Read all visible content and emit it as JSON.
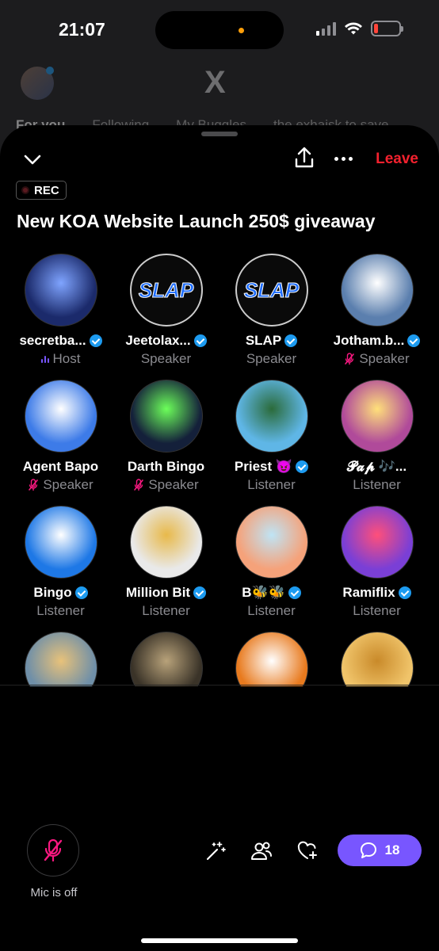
{
  "status_bar": {
    "time": "21:07"
  },
  "background_app": {
    "logo": "X",
    "tabs": [
      "For you",
      "Following",
      "My Buggles",
      "the exhaisk to save"
    ]
  },
  "space": {
    "leave_label": "Leave",
    "rec_label": "REC",
    "title": "New KOA Website Launch 250$ giveaway"
  },
  "participants": [
    {
      "name": "secretba...",
      "role": "Host",
      "verified": true,
      "role_icon": "speaking-bars-icon",
      "avatar_bg": "#1b2a6b",
      "avatar_fg": "#7fa4ff",
      "avatar_text": ""
    },
    {
      "name": "Jeetolax...",
      "role": "Speaker",
      "verified": true,
      "role_icon": "",
      "avatar_bg": "#0a0a0a",
      "avatar_fg": "#1d6cff",
      "avatar_text": "SLAP"
    },
    {
      "name": "SLAP",
      "role": "Speaker",
      "verified": true,
      "role_icon": "",
      "avatar_bg": "#0a0a0a",
      "avatar_fg": "#1d6cff",
      "avatar_text": "SLAP"
    },
    {
      "name": "Jotham.b...",
      "role": "Speaker",
      "verified": true,
      "role_icon": "mic-off-icon",
      "avatar_bg": "#5b7fae",
      "avatar_fg": "#fff",
      "avatar_text": ""
    },
    {
      "name": "Agent Bapo",
      "role": "Speaker",
      "verified": false,
      "role_icon": "mic-off-icon",
      "avatar_bg": "#3d7be8",
      "avatar_fg": "#fff",
      "avatar_text": ""
    },
    {
      "name": "Darth Bingo",
      "role": "Speaker",
      "verified": false,
      "role_icon": "mic-off-icon",
      "avatar_bg": "#14203a",
      "avatar_fg": "#6cff5a",
      "avatar_text": ""
    },
    {
      "name": "Priest 😈",
      "role": "Listener",
      "verified": true,
      "role_icon": "",
      "avatar_bg": "#5fb6e6",
      "avatar_fg": "#2b6b3a",
      "avatar_text": ""
    },
    {
      "name": "𝓟𝓪𝓹 🎶...",
      "role": "Listener",
      "verified": false,
      "role_icon": "",
      "avatar_bg": "#b04a9a",
      "avatar_fg": "#ffe07a",
      "avatar_text": ""
    },
    {
      "name": "Bingo",
      "role": "Listener",
      "verified": true,
      "role_icon": "",
      "avatar_bg": "#1e78e6",
      "avatar_fg": "#fff",
      "avatar_text": ""
    },
    {
      "name": "Million Bit",
      "role": "Listener",
      "verified": true,
      "role_icon": "",
      "avatar_bg": "#e9e9e9",
      "avatar_fg": "#e8b94a",
      "avatar_text": ""
    },
    {
      "name": "B🐝🐝",
      "role": "Listener",
      "verified": true,
      "role_icon": "",
      "avatar_bg": "#f5a27a",
      "avatar_fg": "#bfe4f5",
      "avatar_text": ""
    },
    {
      "name": "Ramiflix",
      "role": "Listener",
      "verified": true,
      "role_icon": "",
      "avatar_bg": "#7a3fd6",
      "avatar_fg": "#ff4f7a",
      "avatar_text": ""
    },
    {
      "name": "",
      "role": "",
      "verified": false,
      "role_icon": "",
      "avatar_bg": "#6f8fa8",
      "avatar_fg": "#e8c27a",
      "avatar_text": ""
    },
    {
      "name": "",
      "role": "",
      "verified": false,
      "role_icon": "",
      "avatar_bg": "#3a3328",
      "avatar_fg": "#b8a27a",
      "avatar_text": ""
    },
    {
      "name": "",
      "role": "",
      "verified": false,
      "role_icon": "",
      "avatar_bg": "#e87a1e",
      "avatar_fg": "#fff",
      "avatar_text": ""
    },
    {
      "name": "",
      "role": "",
      "verified": false,
      "role_icon": "",
      "avatar_bg": "#f0c46a",
      "avatar_fg": "#c98a2a",
      "avatar_text": ""
    }
  ],
  "bottom_bar": {
    "mic_label": "Mic is off",
    "reply_count": "18"
  },
  "colors": {
    "accent_purple": "#7856ff",
    "leave_red": "#f4212e",
    "verified_blue": "#1d9bf0",
    "role_grey": "#8b8b90"
  }
}
